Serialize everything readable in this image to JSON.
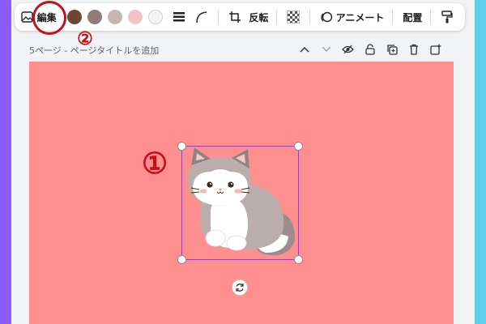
{
  "toolbar": {
    "edit_label": "編集",
    "flip_label": "反転",
    "animate_label": "アニメート",
    "position_label": "配置",
    "colors": [
      "#6e4733",
      "#8e7c78",
      "#c7b5b3",
      "#f1c3c3",
      "#f3f3f3"
    ]
  },
  "annotations": {
    "marker_1": "①",
    "marker_2": "②"
  },
  "page": {
    "title": "5ページ - ページタイトルを追加"
  },
  "canvas": {
    "background": "#ff8f8f"
  }
}
